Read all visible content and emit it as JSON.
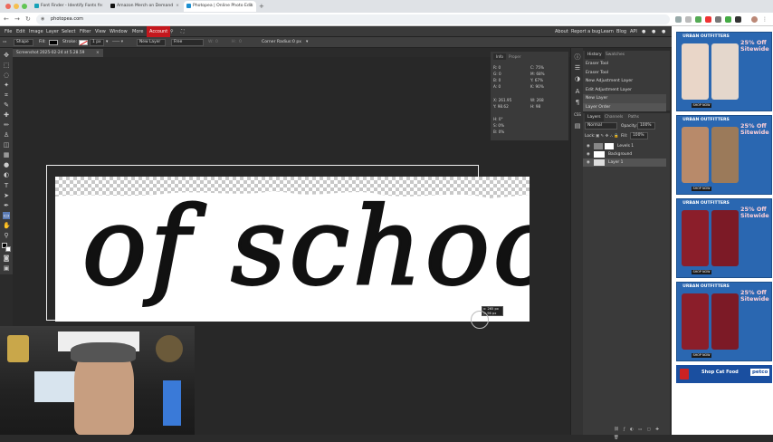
{
  "browser": {
    "tabs": [
      {
        "label": "Font Finder - Identify Fonts fr",
        "color": "#17a2b8"
      },
      {
        "label": "Amazon Merch on Demand",
        "color": "#111111"
      },
      {
        "label": "Photopea | Online Photo Edit",
        "color": "#1c8fd1",
        "active": true
      }
    ],
    "new_tab": "+",
    "url": "photopea.com",
    "traffic_lights": [
      "#ed6a5e",
      "#f5bf4f",
      "#61c554"
    ]
  },
  "menu": {
    "items": [
      "File",
      "Edit",
      "Image",
      "Layer",
      "Select",
      "Filter",
      "View",
      "Window",
      "More"
    ],
    "account": "Account",
    "right_links": [
      "About",
      "Report a bug",
      "Learn",
      "Blog",
      "API"
    ]
  },
  "options": {
    "shape": "Shape",
    "fill_label": "Fill:",
    "stroke_label": "Stroke:",
    "stroke_size": "1 px",
    "new_layer": "New Layer",
    "free": "Free",
    "w_label": "W:",
    "w_value": "0",
    "h_label": "H:",
    "h_value": "0",
    "corner_radius": "Corner Radius:",
    "corner_value": "0 px"
  },
  "document": {
    "tab": "Screenshot 2025-02-24 at 5.28.59",
    "close": "×"
  },
  "canvas": {
    "text": "of school",
    "cursor_readout": [
      "x: 265 px",
      "y: 96 px"
    ]
  },
  "info_panel": {
    "tabs": [
      "Info",
      "Proper"
    ],
    "rgba": [
      "R: 0",
      "G: 0",
      "B: 0",
      "A: 0"
    ],
    "cmyk": [
      "C: 75%",
      "M: 68%",
      "Y: 67%",
      "K: 90%"
    ],
    "xy": [
      "X: 261.95",
      "Y: 98.62"
    ],
    "wh": [
      "W: 268",
      "H: 98"
    ],
    "hsb": [
      "H: 0°",
      "S: 0%",
      "B: 0%"
    ]
  },
  "history": {
    "tabs": [
      "History",
      "Swatches"
    ],
    "items": [
      "Eraser Tool",
      "Eraser Tool",
      "New Adjustment Layer",
      "Edit Adjustment Layer",
      "New Layer",
      "Layer Order"
    ]
  },
  "layers": {
    "tabs": [
      "Layers",
      "Channels",
      "Paths"
    ],
    "blend": "Normal",
    "opacity_label": "Opacity:",
    "opacity": "100%",
    "lock_label": "Lock:",
    "fill_label": "Fill:",
    "fill": "100%",
    "items": [
      "Levels 1",
      "Background",
      "Layer 1"
    ]
  },
  "ads": {
    "brand": "URBAN OUTFITTERS",
    "offer": "25% Off Sitewide",
    "cta": "SHOP NOW",
    "petco_cta": "Shop Cat Food",
    "petco_brand": "petco"
  },
  "colors": {
    "account": "#c4171d",
    "ad_bg": "#2a67b1",
    "workspace": "#282828"
  }
}
